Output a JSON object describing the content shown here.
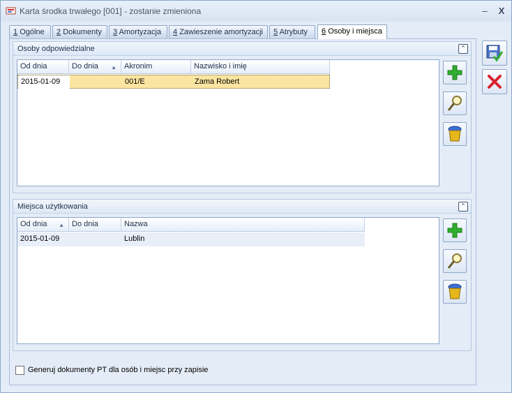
{
  "window": {
    "title": "Karta środka trwałego [001] - zostanie zmieniona",
    "minimize_glyph": "–",
    "close_glyph": "X"
  },
  "tabs": [
    {
      "num": "1",
      "label": "Ogólne"
    },
    {
      "num": "2",
      "label": "Dokumenty"
    },
    {
      "num": "3",
      "label": "Amortyzacja"
    },
    {
      "num": "4",
      "label": "Zawieszenie amortyzacji"
    },
    {
      "num": "5",
      "label": "Atrybuty"
    },
    {
      "num": "6",
      "label": "Osoby i miejsca"
    }
  ],
  "active_tab": "Osoby i miejsca",
  "persons": {
    "title": "Osoby odpowiedzialne",
    "collapse_glyph": "⌃",
    "columns": [
      "Od dnia",
      "Do dnia",
      "Akronim",
      "Nazwisko i imię"
    ],
    "sort_glyph": "▲",
    "rows": [
      {
        "od_dnia": "2015-01-09",
        "do_dnia": "",
        "akronim": "001/E",
        "nazwisko": "Zama Robert"
      }
    ]
  },
  "places": {
    "title": "Miejsca użytkowania",
    "collapse_glyph": "⌃",
    "columns": [
      "Od dnia",
      "Do dnia",
      "Nazwa"
    ],
    "sort_glyph": "▲",
    "rows": [
      {
        "od_dnia": "2015-01-09",
        "do_dnia": "",
        "nazwa": "Lublin"
      }
    ]
  },
  "checkbox": {
    "label": "Generuj dokumenty PT dla osób i miejsc przy zapisie",
    "checked": false
  },
  "icons": {
    "add": "plus-icon",
    "edit": "magnifier-icon",
    "delete": "trash-icon",
    "save": "save-icon",
    "cancel": "cancel-icon"
  },
  "colors": {
    "selected_row": "#fbe5a1",
    "add_green": "#2fae2f",
    "cancel_red": "#d9232d"
  }
}
